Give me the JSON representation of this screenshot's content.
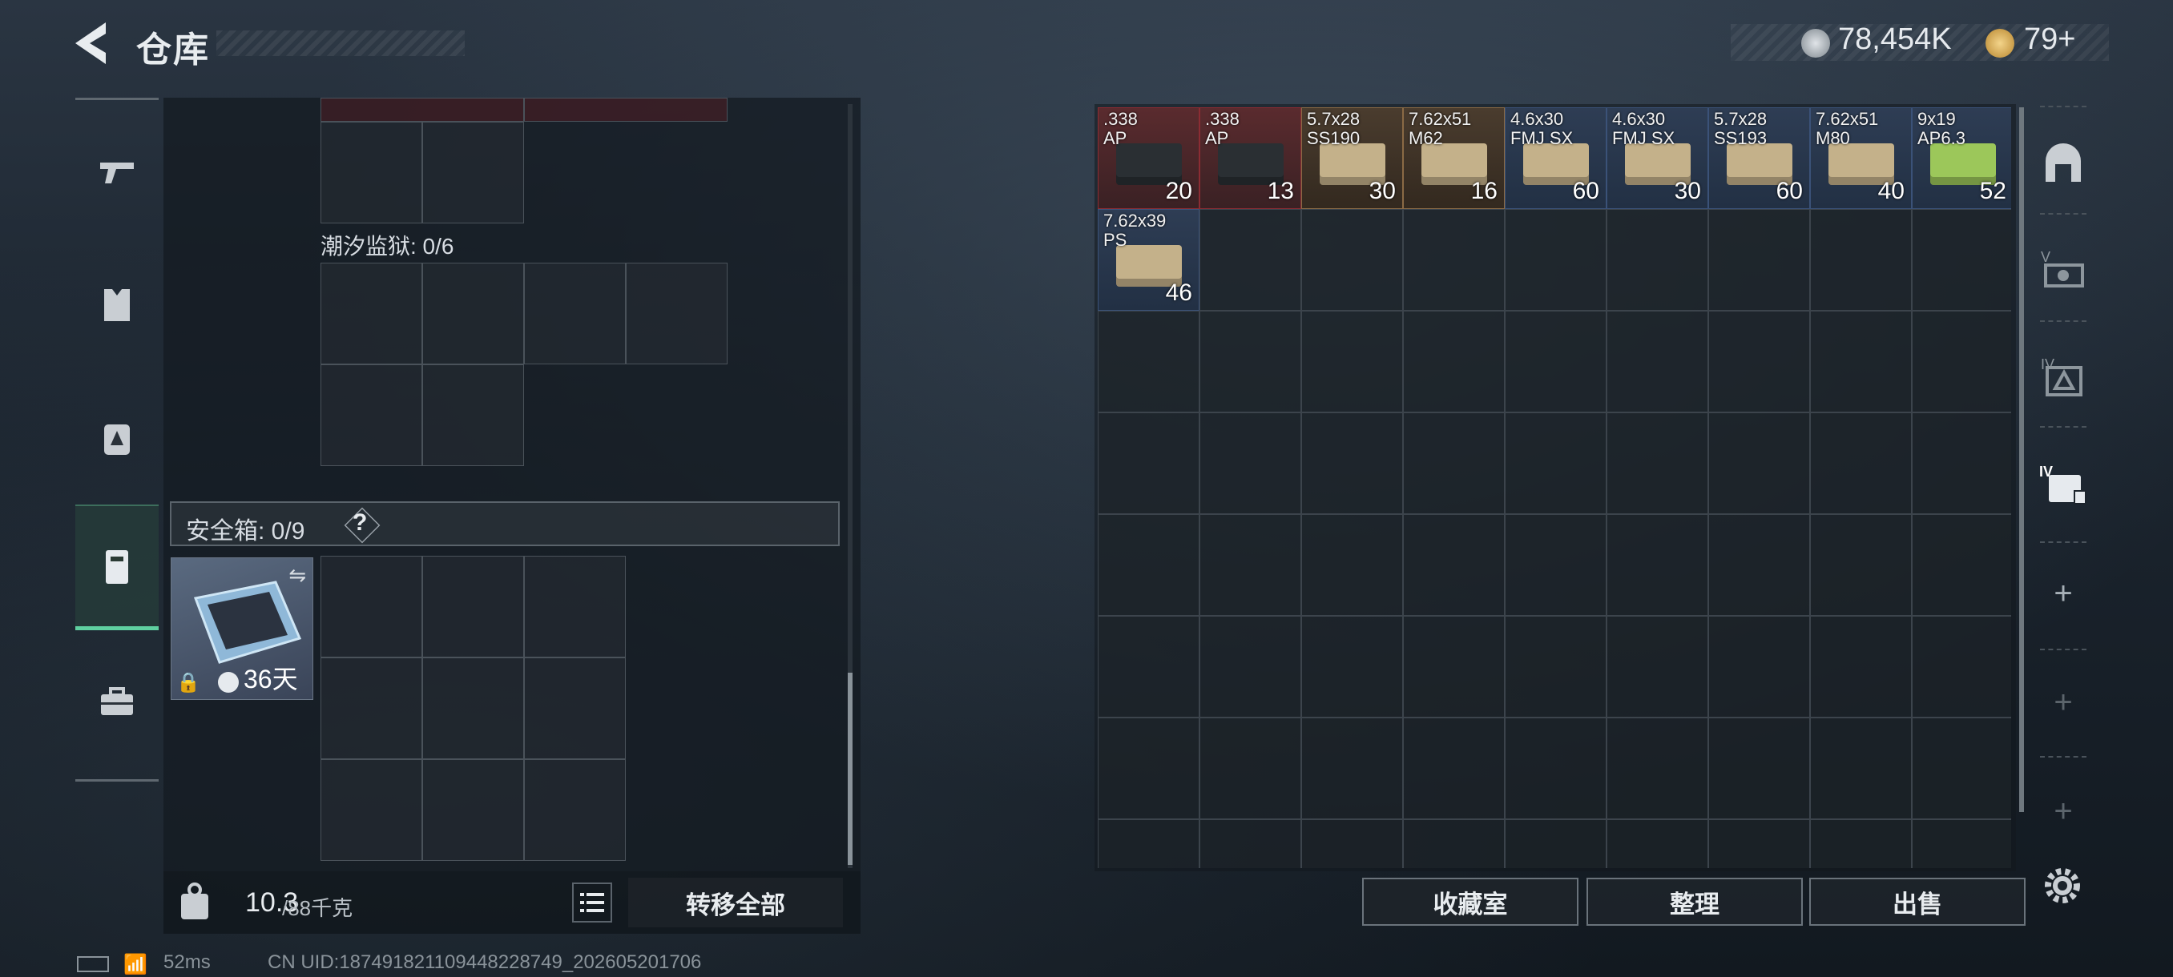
{
  "header": {
    "title": "仓库"
  },
  "currency": {
    "coins": "78,454K",
    "tokens": "79+"
  },
  "left": {
    "tidal_prison_label": "潮汐监狱: 0/6",
    "safe_box_label": "安全箱: 0/9",
    "help_mark": "?",
    "safe_box_days": "36天",
    "weight_current": "10.3",
    "weight_max": "/88千克",
    "transfer_all": "转移全部"
  },
  "items": [
    {
      "line1": ".338",
      "line2": "AP",
      "count": "20",
      "rarity": "red",
      "color": "#8b2c33"
    },
    {
      "line1": ".338",
      "line2": "AP",
      "count": "13",
      "rarity": "red",
      "color": "#8b2c33"
    },
    {
      "line1": "5.7x28",
      "line2": "SS190",
      "count": "30",
      "rarity": "brown",
      "color": "#8a6a45"
    },
    {
      "line1": "7.62x51",
      "line2": "M62",
      "count": "16",
      "rarity": "brown",
      "color": "#8a6a45"
    },
    {
      "line1": "4.6x30",
      "line2": "FMJ SX",
      "count": "60",
      "rarity": "blue",
      "color": "#3b5278"
    },
    {
      "line1": "4.6x30",
      "line2": "FMJ SX",
      "count": "30",
      "rarity": "blue",
      "color": "#3b5278"
    },
    {
      "line1": "5.7x28",
      "line2": "SS193",
      "count": "60",
      "rarity": "blue",
      "color": "#3b5278"
    },
    {
      "line1": "7.62x51",
      "line2": "M80",
      "count": "40",
      "rarity": "blue",
      "color": "#3b5278"
    },
    {
      "line1": "9x19",
      "line2": "AP6.3",
      "count": "52",
      "rarity": "blue",
      "color": "#3b5278"
    },
    {
      "line1": "7.62x39",
      "line2": "PS",
      "count": "46",
      "rarity": "blue",
      "color": "#3b5278"
    }
  ],
  "right_buttons": {
    "collection": "收藏室",
    "organize": "整理",
    "sell": "出售"
  },
  "status": {
    "ping": "52ms",
    "uid": "CN UID:1874918211094482287​49_202605201706"
  }
}
